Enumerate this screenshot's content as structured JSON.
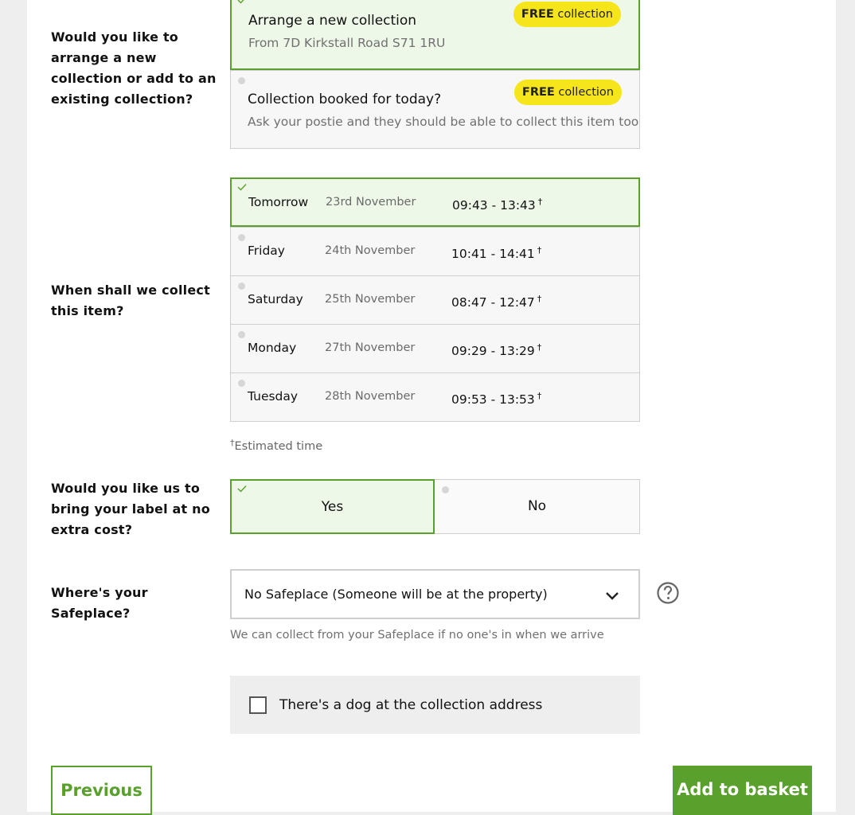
{
  "collection_method": {
    "question": "Would you like to arrange a new collection or add to an existing collection?",
    "options": [
      {
        "title": "Arrange a new collection",
        "subtitle": "From 7D Kirkstall Road S71 1RU",
        "badge_strong": "FREE",
        "badge_rest": "collection",
        "selected": true
      },
      {
        "title": "Collection booked for today?",
        "subtitle": "Ask your postie and they should be able to collect this item too",
        "badge_strong": "FREE",
        "badge_rest": "collection",
        "selected": false
      }
    ]
  },
  "collection_date": {
    "question": "When shall we collect this item?",
    "slots": [
      {
        "day": "Tomorrow",
        "date": "23rd November",
        "time": "09:43 - 13:43",
        "selected": true
      },
      {
        "day": "Friday",
        "date": "24th November",
        "time": "10:41 - 14:41",
        "selected": false
      },
      {
        "day": "Saturday",
        "date": "25th November",
        "time": "08:47 - 12:47",
        "selected": false
      },
      {
        "day": "Monday",
        "date": "27th November",
        "time": "09:29 - 13:29",
        "selected": false
      },
      {
        "day": "Tuesday",
        "date": "28th November",
        "time": "09:53 - 13:53",
        "selected": false
      }
    ],
    "dagger": "†",
    "footnote": "Estimated time"
  },
  "label_option": {
    "question": "Would you like us to bring your label at no extra cost?",
    "yes": "Yes",
    "no": "No",
    "selected": "Yes"
  },
  "safeplace": {
    "question": "Where's your Safeplace?",
    "value": "No Safeplace (Someone will be at the property)",
    "hint": "We can collect from your Safeplace if no one's in when we arrive",
    "help_icon": "question-circle-icon"
  },
  "dog": {
    "label": "There's a dog at the collection address",
    "checked": false
  },
  "actions": {
    "previous": "Previous",
    "add_to_basket": "Add to basket"
  },
  "colors": {
    "accent_green": "#5aa02c",
    "selected_bg": "#eef8e8",
    "badge_yellow": "#f7e51c"
  }
}
